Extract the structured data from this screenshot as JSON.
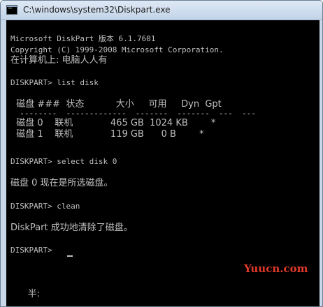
{
  "window": {
    "title": "C:\\windows\\system32\\Diskpart.exe"
  },
  "console": {
    "lines": [
      "Microsoft DiskPart 版本 6.1.7601",
      "Copyright (C) 1999-2008 Microsoft Corporation.",
      "在计算机上: 电脑人人有",
      "DISKPART> list disk",
      "  磁盘 ###  状态           大小     可用     Dyn  Gpt",
      "  --------  -------------  -------  -------  ---  ---",
      "  磁盘 0    联机             465 GB  1024 KB        *",
      "  磁盘 1    联机             119 GB      0 B        *",
      "DISKPART> select disk 0",
      "磁盘 0 现在是所选磁盘。",
      "DISKPART> clean",
      "DiskPart 成功地清除了磁盘。",
      "DISKPART> ",
      "      半:"
    ]
  },
  "disks_table": {
    "headers": [
      "磁盘 ###",
      "状态",
      "大小",
      "可用",
      "Dyn",
      "Gpt"
    ],
    "rows": [
      [
        "磁盘 0",
        "联机",
        "465 GB",
        "1024 KB",
        "",
        "*"
      ],
      [
        "磁盘 1",
        "联机",
        "119 GB",
        "0 B",
        "",
        "*"
      ]
    ]
  },
  "watermark": {
    "text": "Yuucn.com",
    "color": "#e0392b"
  },
  "colors": {
    "console_bg": "#000000",
    "console_text": "#c0c0c0",
    "title_bar": "#c9d8e8"
  },
  "icons": {
    "app_icon": "console-window-icon"
  }
}
